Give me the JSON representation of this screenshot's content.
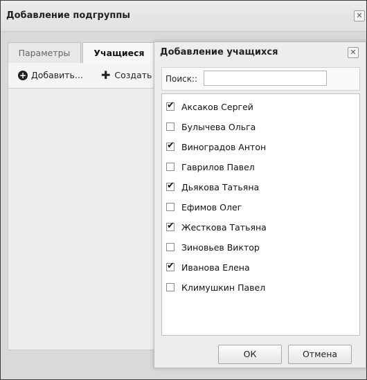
{
  "outer": {
    "title": "Добавление подгруппы",
    "close_glyph": "✕",
    "tabs": [
      {
        "label": "Параметры"
      },
      {
        "label": "Учащиеся"
      }
    ],
    "toolbar": {
      "add_label": "Добавить...",
      "create_label": "Создать"
    }
  },
  "dialog": {
    "title": "Добавление учащихся",
    "close_glyph": "✕",
    "search": {
      "label": "Поиск::",
      "value": ""
    },
    "students": [
      {
        "name": "Аксаков Сергей",
        "checked": true
      },
      {
        "name": "Булычева Ольга",
        "checked": false
      },
      {
        "name": "Виноградов Антон",
        "checked": true
      },
      {
        "name": "Гаврилов Павел",
        "checked": false
      },
      {
        "name": "Дьякова Татьяна",
        "checked": true
      },
      {
        "name": "Ефимов Олег",
        "checked": false
      },
      {
        "name": "Жесткова Татьяна",
        "checked": true
      },
      {
        "name": "Зиновьев Виктор",
        "checked": false
      },
      {
        "name": "Иванова Елена",
        "checked": true
      },
      {
        "name": "Климушкин Павел",
        "checked": false
      }
    ],
    "ok_label": "ОК",
    "cancel_label": "Отмена"
  }
}
